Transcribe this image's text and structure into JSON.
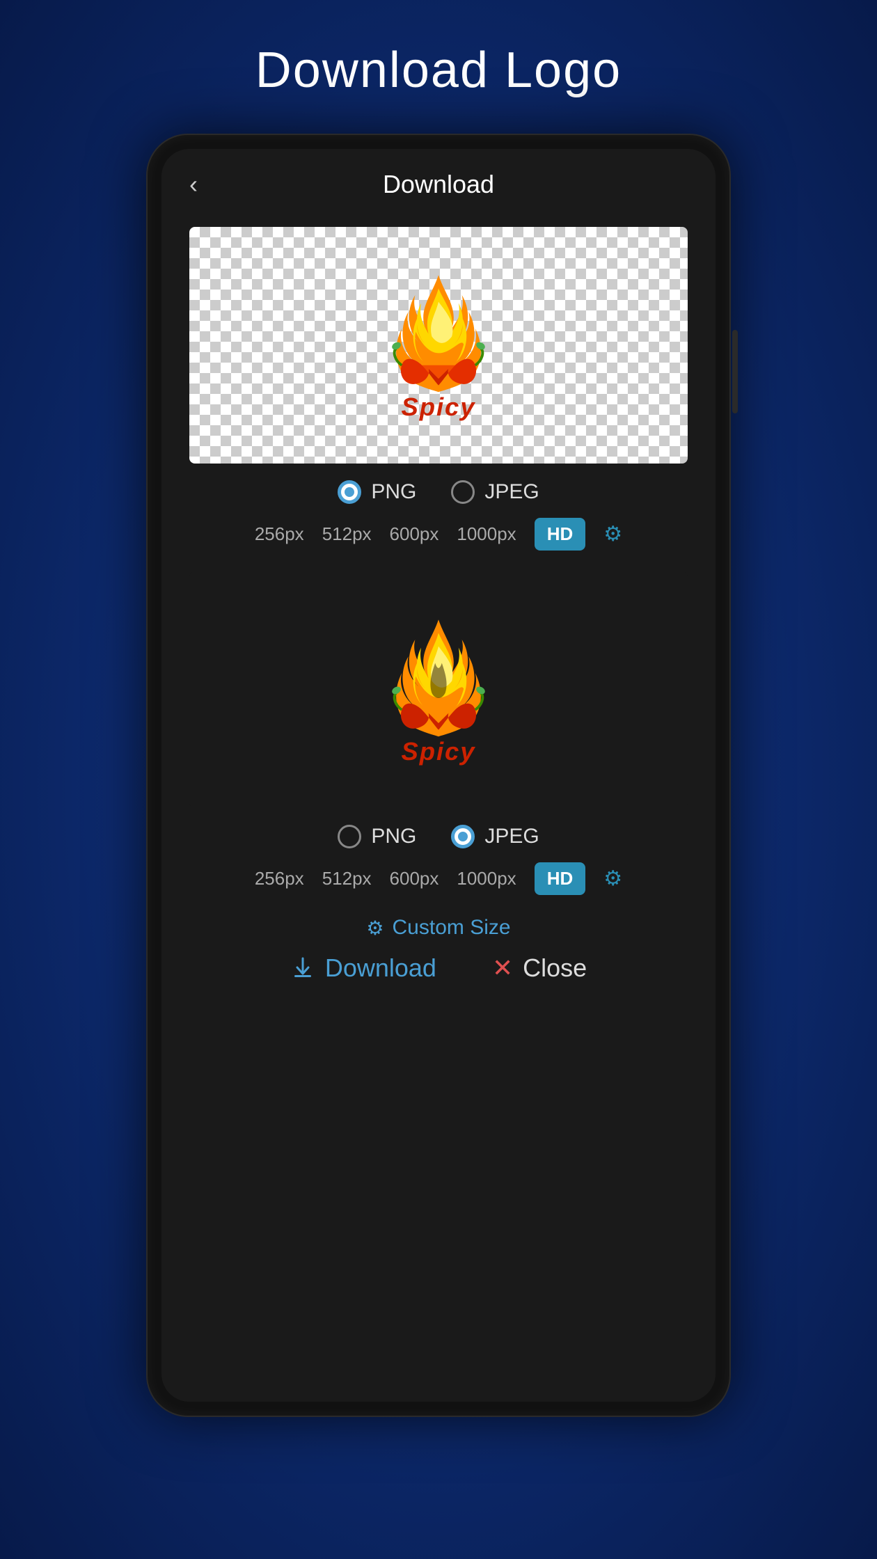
{
  "page": {
    "title": "Download Logo",
    "background_gradient": "radial-gradient(ellipse at center, #1a4a9f 0%, #0d2a6e 50%, #071a4a 100%)"
  },
  "screen": {
    "title": "Download",
    "back_button_label": "‹"
  },
  "section1": {
    "format_options": [
      "PNG",
      "JPEG"
    ],
    "selected_format": "PNG",
    "sizes": [
      "256px",
      "512px",
      "600px",
      "1000px",
      "HD"
    ],
    "hd_label": "HD",
    "gear_label": "⚙"
  },
  "section2": {
    "format_options": [
      "PNG",
      "JPEG"
    ],
    "selected_format": "JPEG",
    "sizes": [
      "256px",
      "512px",
      "600px",
      "1000px",
      "HD"
    ],
    "hd_label": "HD",
    "gear_label": "⚙"
  },
  "custom_size": {
    "label": "Custom Size",
    "gear_icon": "⚙"
  },
  "actions": {
    "download_label": "Download",
    "close_label": "Close"
  }
}
